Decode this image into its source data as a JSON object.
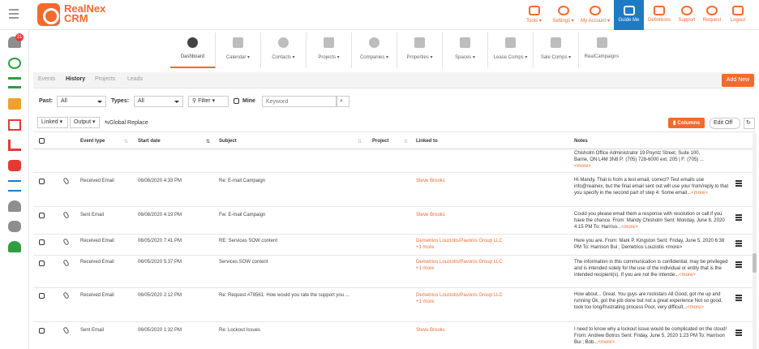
{
  "brand": {
    "line1": "RealNex",
    "line2": "CRM"
  },
  "topnav": [
    {
      "label": "Tools",
      "icon": "tools-icon"
    },
    {
      "label": "Settings",
      "icon": "gear-icon"
    },
    {
      "label": "My Account",
      "icon": "user-circle-icon"
    },
    {
      "label": "Guide Me",
      "icon": "guide-book-icon",
      "active": true
    },
    {
      "label": "Definitions",
      "icon": "book-icon"
    },
    {
      "label": "Support",
      "icon": "headset-icon"
    },
    {
      "label": "Request",
      "icon": "lightbulb-icon"
    },
    {
      "label": "Logout",
      "icon": "logout-icon"
    }
  ],
  "sidebar": {
    "notification_count": "21"
  },
  "modules": [
    {
      "label": "Dashboard",
      "active": true
    },
    {
      "label": "Calendar"
    },
    {
      "label": "Contacts"
    },
    {
      "label": "Projects"
    },
    {
      "label": "Companies"
    },
    {
      "label": "Properties"
    },
    {
      "label": "Spaces"
    },
    {
      "label": "Lease Comps"
    },
    {
      "label": "Sale Comps"
    },
    {
      "label": "RealCampaigns"
    }
  ],
  "tabs": [
    "Events",
    "History",
    "Projects",
    "Leads"
  ],
  "add_new": "Add New",
  "filters": {
    "past_label": "Past:",
    "past_value": "All",
    "types_label": "Types:",
    "types_value": "All",
    "filter_btn": "Filter",
    "mine_label": "Mine",
    "keyword_placeholder": "Keyword"
  },
  "toolbar": {
    "linked": "Linked",
    "output": "Output",
    "global_replace": "Global Replace",
    "columns": "Columns",
    "edit_off": "Edit Off"
  },
  "columns": {
    "event_type": "Event type",
    "start_date": "Start date",
    "subject": "Subject",
    "project": "Project",
    "linked_to": "Linked to",
    "notes": "Notes"
  },
  "partial_note": {
    "line1": "Chisholm Office Administrator    19 Poyntz Street, Suite 100,",
    "line2": "Barrie, ON L4M 3N8 P: (705) 728-6000 ext. 205 | F: (705) ...",
    "more": "<more>"
  },
  "rows": [
    {
      "event_type": "Received Email",
      "date": "06/08/2020 4:33 PM",
      "subject": "Re: E-mail Campaign",
      "linked": "Steve Brooks",
      "linked_more": "",
      "notes": "Hi Mandy, That is from a test email, correct? Test emails use info@realnex, but the final email sent out will use your from/reply to that you specify in the second part of step 4: Some email...",
      "more": "<more>"
    },
    {
      "event_type": "Sent Email",
      "date": "06/08/2020 4:19 PM",
      "subject": "Fw: E-mail Campaign",
      "linked": "Steve Brooks",
      "linked_more": "",
      "notes": "Could you please email them a response with resolution or call if you have the chance. From: Mandy Chisholm Sent: Monday, June 8, 2020 4:15 PM To: Harriso...",
      "more": "<more>"
    },
    {
      "event_type": "Received Email",
      "date": "06/05/2020 7:41 PM",
      "subject": "RE: Services SOW content",
      "linked": "Demetrios Louziotis/Pavonis Group LLC",
      "linked_more": "+1 more",
      "notes": "Here you are.   From: Mark P. Kingston Sent: Friday, June 5, 2020 6:38 PM To: Harrison Bui ; Demetrios Louziotis <more>",
      "more": ""
    },
    {
      "event_type": "Received Email",
      "date": "06/05/2020 5:37 PM",
      "subject": "Services SOW content",
      "linked": "Demetrios Louziotis/Pavonis Group LLC",
      "linked_more": "+1 more",
      "notes": "The information in this communication is confidential, may be privileged and is intended solely for the use of the individual or entity that is the intended recipient(s). If you are not the intende...",
      "more": "<more>"
    },
    {
      "event_type": "Received Email",
      "date": "06/05/2020 2:12 PM",
      "subject": "Re: Request #78561: How would you rate the support you ...",
      "linked": "Demetrios Louziotis/Pavonis Group LLC",
      "linked_more": "+1 more",
      "notes": "How about...  Great. You guys are rockstars All Good, got me up and running Ok, got the job done but not a great experience Not so good, took too long/frustrating process Poor, very difficult...",
      "more": "<more>"
    },
    {
      "event_type": "Sent Email",
      "date": "06/05/2020 1:32 PM",
      "subject": "Re: Lockout Issues",
      "linked": "Steve Brooks",
      "linked_more": "",
      "notes": "I need to know why a lockout issue would be complicated on the cloud!  From: Andrew Botros Sent: Friday, June 5, 2020 1:23 PM To: Harrison Bui ; Bob...",
      "more": "<more>"
    }
  ]
}
